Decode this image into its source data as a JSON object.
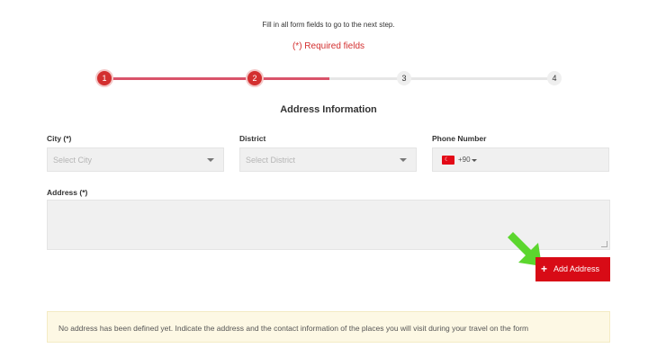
{
  "instruction": "Fill in all form fields to go to the next step.",
  "required_note": "(*) Required fields",
  "steps": [
    {
      "number": "1",
      "state": "active"
    },
    {
      "number": "2",
      "state": "active"
    },
    {
      "number": "3",
      "state": "inactive"
    },
    {
      "number": "4",
      "state": "inactive"
    }
  ],
  "progress_fraction": 0.5,
  "section_title": "Address Information",
  "city": {
    "label": "City (*)",
    "placeholder": "Select City"
  },
  "district": {
    "label": "District",
    "placeholder": "Select District"
  },
  "phone": {
    "label": "Phone Number",
    "country_code": "+90",
    "flag": "turkey-flag-icon"
  },
  "address": {
    "label": "Address (*)",
    "value": ""
  },
  "add_address_button": {
    "label": "Add Address",
    "icon": "plus-icon"
  },
  "notice": "No address has been defined yet. Indicate the address and the contact information of the places you will visit during your travel on the form",
  "colors": {
    "accent": "#d32f2f",
    "button": "#d80b16",
    "progress": "#d9536a",
    "arrow": "#5cd62e",
    "notice_bg": "#fdf8e4"
  }
}
